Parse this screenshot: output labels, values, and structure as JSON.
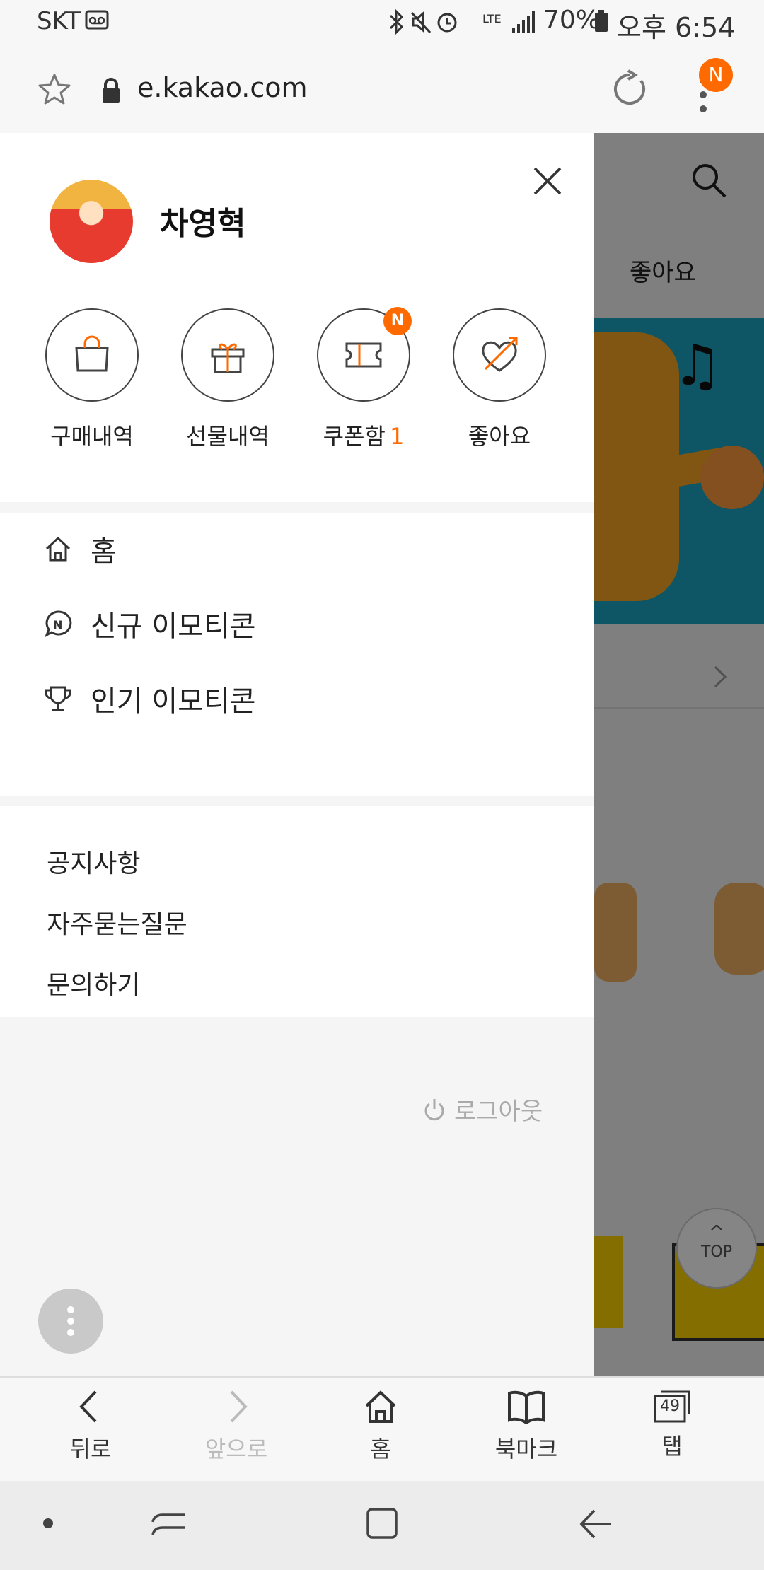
{
  "status_bar": {
    "carrier": "SKT",
    "battery": "70%",
    "time": "오후 6:54"
  },
  "browser": {
    "url": "e.kakao.com",
    "notification_badge": "N"
  },
  "background_page": {
    "tab_label": "좋아요",
    "top_button": "TOP"
  },
  "drawer": {
    "user_name": "차영혁",
    "quick_menu": [
      {
        "label": "구매내역",
        "icon": "shopping-bag-icon"
      },
      {
        "label": "선물내역",
        "icon": "gift-icon"
      },
      {
        "label": "쿠폰함",
        "count": "1",
        "badge": "N",
        "icon": "coupon-icon"
      },
      {
        "label": "좋아요",
        "icon": "heart-arrow-icon"
      }
    ],
    "nav_items": [
      {
        "label": "홈",
        "icon": "home-icon"
      },
      {
        "label": "신규 이모티콘",
        "icon": "new-chat-icon"
      },
      {
        "label": "인기 이모티콘",
        "icon": "trophy-icon"
      }
    ],
    "help_items": [
      "공지사항",
      "자주묻는질문",
      "문의하기"
    ],
    "logout": "로그아웃"
  },
  "toolbar": {
    "back": "뒤로",
    "forward": "앞으로",
    "home": "홈",
    "bookmarks": "북마크",
    "tabs": "탭",
    "tab_count": "49"
  },
  "colors": {
    "accent": "#ff6a00",
    "banner": "#1ba3c2"
  }
}
